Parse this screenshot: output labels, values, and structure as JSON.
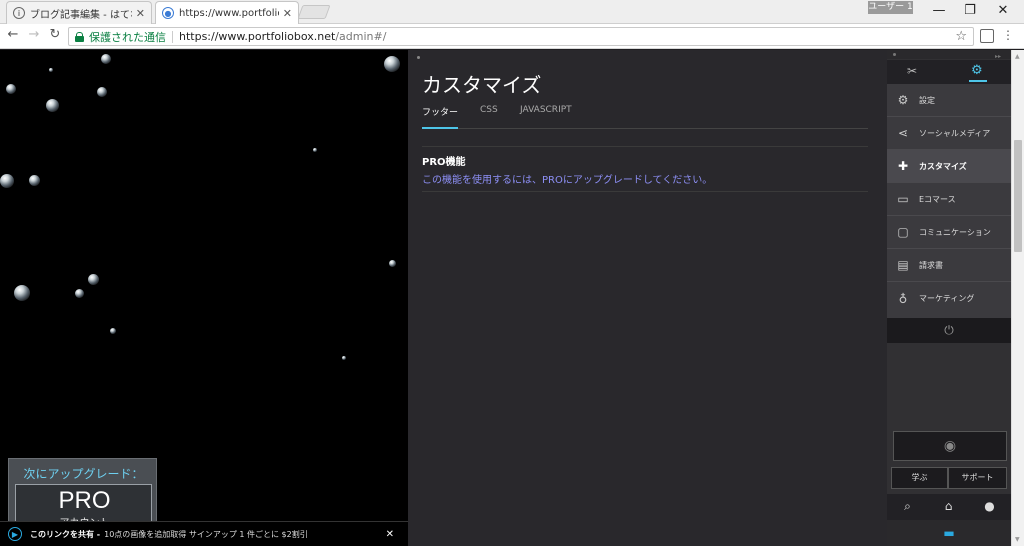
{
  "browser": {
    "tabs": [
      {
        "title": "ブログ記事編集 - はてなブロ",
        "icon": "info-icon",
        "close": "✕"
      },
      {
        "title": "https://www.portfoliobox",
        "icon": "globe-icon",
        "close": "✕"
      }
    ],
    "user_badge": "ユーザー 1",
    "window_controls": {
      "minimize": "—",
      "maximize": "❐",
      "close": "✕"
    },
    "nav": {
      "back": "←",
      "forward": "→",
      "reload": "↻"
    },
    "secure_label": "保護された通信",
    "url_host": "https://www.portfoliobox.net",
    "url_path": "/admin#/",
    "bookmark_icon": "☆",
    "menu_icon": "⋮"
  },
  "preview": {
    "upgrade_title": "次にアップグレード：",
    "upgrade_big": "PRO",
    "upgrade_sub": "アカウント",
    "share_bar": {
      "bold": "このリンクを共有 -",
      "text": "10点の画像を追加取得 サインアップ 1 件ごとに $2割引",
      "close": "✕"
    }
  },
  "editor": {
    "title": "カスタマイズ",
    "tabs": [
      "フッター",
      "CSS",
      "JAVASCRIPT"
    ],
    "pro_label": "PRO機能",
    "pro_message": "この機能を使用するには、PROにアップグレードしてください。"
  },
  "sidebar": {
    "top_icons": {
      "tools": "✂",
      "settings": "⚙"
    },
    "menu": [
      {
        "label": "設定",
        "icon": "gears-icon",
        "glyph": "⚙"
      },
      {
        "label": "ソーシャルメディア",
        "icon": "share-icon",
        "glyph": "⋖"
      },
      {
        "label": "カスタマイズ",
        "icon": "puzzle-icon",
        "glyph": "✚"
      },
      {
        "label": "Eコマース",
        "icon": "credit-card-icon",
        "glyph": "▭"
      },
      {
        "label": "コミュニケーション",
        "icon": "chat-icon",
        "glyph": "▢"
      },
      {
        "label": "請求書",
        "icon": "invoice-icon",
        "glyph": "▤"
      },
      {
        "label": "マーケティング",
        "icon": "lightbulb-icon",
        "glyph": "♁"
      }
    ],
    "power": "⏻",
    "preview_eye": "◉",
    "learn": "学ぶ",
    "support": "サポート",
    "bottom_icons": {
      "search": "⌕",
      "basket": "⌂",
      "globe": "●"
    },
    "chat": "▬"
  },
  "colors": {
    "accent": "#4ec5e8",
    "pro_link": "#8d8ff5",
    "secure": "#0b8043"
  }
}
